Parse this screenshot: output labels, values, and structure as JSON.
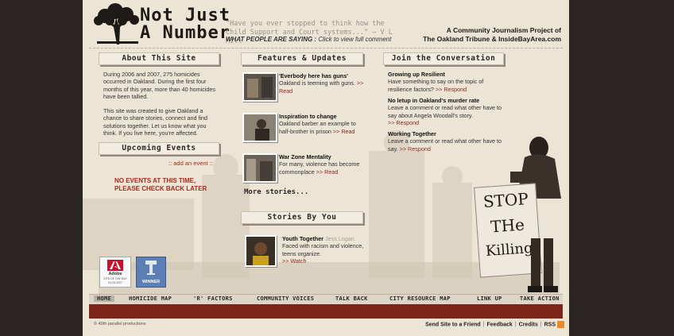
{
  "header": {
    "logo_line1": "Not Just",
    "logo_line2": "A Number",
    "quote": "\"Have you ever stopped to think how the Child Support and Court systems...\" – V L Mill",
    "quote_cta_bold": "WHAT PEOPLE ARE SAYING :",
    "quote_cta_link": "Click to view full comment",
    "tagline_line1": "A Community Journalism Project of",
    "tagline_line2": "The Oakland Tribune & InsideBayArea.com"
  },
  "about": {
    "title": "About This Site",
    "para1": "During 2006 and 2007, 275 homicides occurred in Oakland. During the first four months of this year, more than 40 homicides have been tallied.",
    "para2": "This site was created to give Oakland a chance to share stories, connect and find solutions together. Let us know what you think. If you live here, you're affected."
  },
  "events": {
    "title": "Upcoming Events",
    "add_link": ":: add an event ::",
    "empty_line1": "NO EVENTS AT THIS TIME,",
    "empty_line2": "PLEASE CHECK BACK LATER"
  },
  "features": {
    "title": "Features & Updates",
    "items": [
      {
        "headline": "'Everbody here has guns'",
        "summary": "Oakland is teeming with guns.",
        "link": ">> Read"
      },
      {
        "headline": "Inspiration to change",
        "summary": "Oakland barber an example to half-brother in prison",
        "link": ">> Read"
      },
      {
        "headline": "War Zone Mentality",
        "summary": "For many, violence has become commonplace",
        "link": ">> Read"
      }
    ],
    "more": "More stories..."
  },
  "stories": {
    "title": "Stories By You",
    "headline": "Youth Together",
    "author": "Jess Logan",
    "summary": "Faced with racism and violence, teens organize.",
    "link": ">> Watch"
  },
  "conversation": {
    "title": "Join the Conversation",
    "items": [
      {
        "headline": "Growing up Resilient",
        "summary": "Have something to say on the topic of resilience factors?",
        "link": ">> Respond"
      },
      {
        "headline": "No letup in Oakland's murder rate",
        "summary": "Leave a comment or read what other have to say about Angela Woodall's story.",
        "link": ">> Respond"
      },
      {
        "headline": "Working Together",
        "summary": "Leave a comment or read what other have to say.",
        "link": ">> Respond"
      }
    ]
  },
  "sign": {
    "line1": "STOP",
    "line2": "THe",
    "line3": "Killing"
  },
  "badges": {
    "adobe_name": "Adobe",
    "adobe_caption": "SITE OF THE DAY",
    "adobe_date": "04-03-2007",
    "winner_label": "WINNER"
  },
  "nav": {
    "items": [
      "HOME",
      "HOMICIDE MAP",
      "'R' FACTORS",
      "COMMUNITY VOICES",
      "TALK BACK",
      "CITY RESOURCE MAP",
      "LINK UP",
      "TAKE ACTION"
    ]
  },
  "footer": {
    "copyright": "© 49th parallel productions",
    "links": [
      "Send Site to a Friend",
      "Feedback",
      "Credits",
      "RSS"
    ]
  },
  "colors": {
    "accent": "#a82a1d",
    "footer_bar": "#7c2417",
    "paper": "#ece4d4",
    "outer": "#2b2623"
  }
}
